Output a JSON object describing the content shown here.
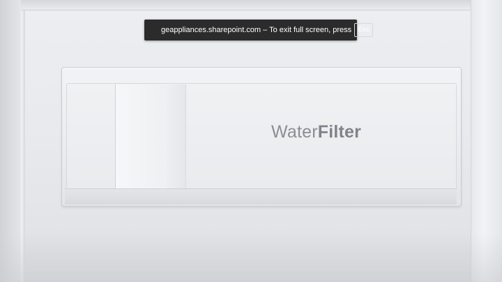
{
  "fullscreen_notice": {
    "message": "geappliances.sharepoint.com – To exit full screen, press",
    "key_label": "Esc"
  },
  "video": {
    "filter_label_light": "Water",
    "filter_label_bold": "Filter"
  }
}
